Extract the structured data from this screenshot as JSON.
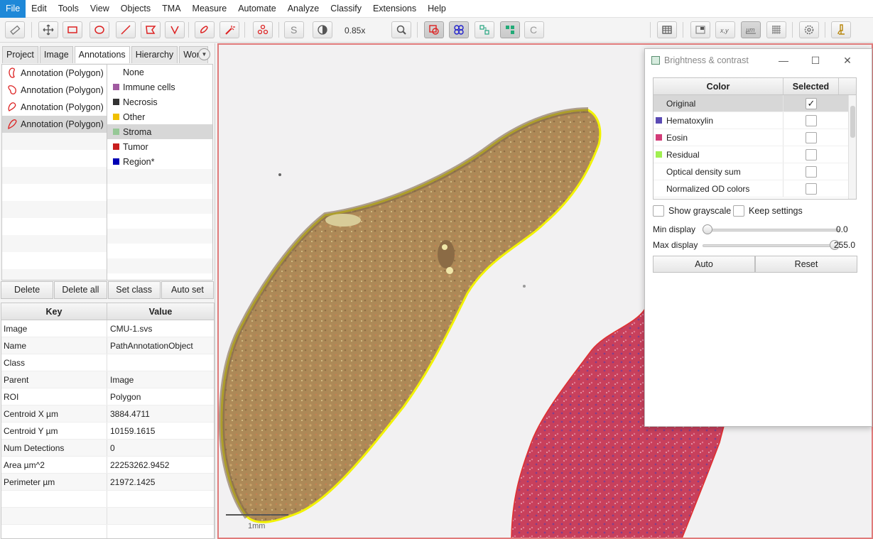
{
  "menu": [
    "File",
    "Edit",
    "Tools",
    "View",
    "Objects",
    "TMA",
    "Measure",
    "Automate",
    "Analyze",
    "Classify",
    "Extensions",
    "Help"
  ],
  "toolbar": {
    "zoom": "0.85x",
    "icons": [
      "ruler-icon",
      "move-icon",
      "rectangle-icon",
      "ellipse-icon",
      "line-icon",
      "polygon-icon",
      "polyline-icon",
      "brush-icon",
      "wand-icon",
      "points-icon",
      "selection-mode-icon",
      "brightness-contrast-icon",
      "zoom-to-fit-icon",
      "show-annotations-icon",
      "show-detections-icon",
      "fill-annotations-icon",
      "fill-detections-icon",
      "show-connections-icon",
      "table-icon",
      "overview-icon",
      "cursor-location-icon",
      "scalebar-icon",
      "grid-icon",
      "preferences-icon",
      "log-icon"
    ]
  },
  "left_panel": {
    "tabs": [
      "Project",
      "Image",
      "Annotations",
      "Hierarchy",
      "Work"
    ],
    "active_tab": "Annotations",
    "annotations": [
      "Annotation (Polygon)",
      "Annotation (Polygon)",
      "Annotation (Polygon)",
      "Annotation (Polygon)"
    ],
    "selected_annotation_index": 3,
    "classes": [
      {
        "name": "None",
        "color": ""
      },
      {
        "name": "Immune cells",
        "color": "#a05aa0"
      },
      {
        "name": "Necrosis",
        "color": "#333333"
      },
      {
        "name": "Other",
        "color": "#f0c000"
      },
      {
        "name": "Stroma",
        "color": "#96c896"
      },
      {
        "name": "Tumor",
        "color": "#c81e1e"
      },
      {
        "name": "Region*",
        "color": "#0000b4"
      }
    ],
    "selected_class_index": 4,
    "buttons": [
      "Delete",
      "Delete all",
      "Set class",
      "Auto set"
    ],
    "properties": {
      "headers": [
        "Key",
        "Value"
      ],
      "rows": [
        [
          "Image",
          "CMU-1.svs"
        ],
        [
          "Name",
          "PathAnnotationObject"
        ],
        [
          "Class",
          ""
        ],
        [
          "Parent",
          "Image"
        ],
        [
          "ROI",
          "Polygon"
        ],
        [
          "Centroid X µm",
          "3884.4711"
        ],
        [
          "Centroid Y µm",
          "10159.1615"
        ],
        [
          "Num Detections",
          "0"
        ],
        [
          "Area µm^2",
          "22253262.9452"
        ],
        [
          "Perimeter µm",
          "21972.1425"
        ]
      ]
    }
  },
  "viewer": {
    "scalebar_label": "1mm",
    "colors": {
      "selected_annotation": "#f2f200",
      "annotation": "#e03030",
      "tissue_he": "#c23a5a",
      "tissue_tinted": "#b08a56"
    }
  },
  "brightness_contrast": {
    "title": "Brightness & contrast",
    "headers": [
      "Color",
      "Selected"
    ],
    "channels": [
      {
        "name": "Original",
        "color": "",
        "selected": true
      },
      {
        "name": "Hematoxylin",
        "color": "#5a4ab4",
        "selected": false
      },
      {
        "name": "Eosin",
        "color": "#d23c78",
        "selected": false
      },
      {
        "name": "Residual",
        "color": "#a0f050",
        "selected": false
      },
      {
        "name": "Optical density sum",
        "color": "",
        "selected": false
      },
      {
        "name": "Normalized OD colors",
        "color": "",
        "selected": false
      }
    ],
    "show_grayscale": "Show grayscale",
    "keep_settings": "Keep settings",
    "min_label": "Min display",
    "min_value": "0.0",
    "max_label": "Max display",
    "max_value": "255.0",
    "min_level": 0,
    "max_level": 1,
    "auto_label": "Auto",
    "reset_label": "Reset"
  }
}
